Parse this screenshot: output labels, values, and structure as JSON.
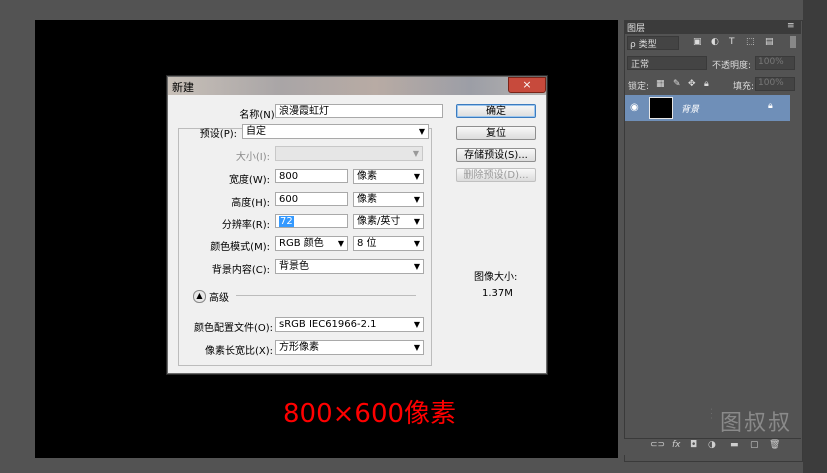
{
  "dialog": {
    "title": "新建",
    "name_label": "名称(N):",
    "name_value": "浪漫霞虹灯",
    "preset_label": "预设(P):",
    "preset_value": "自定",
    "size_label": "大小(I):",
    "width_label": "宽度(W):",
    "width_value": "800",
    "width_unit": "像素",
    "height_label": "高度(H):",
    "height_value": "600",
    "height_unit": "像素",
    "resolution_label": "分辨率(R):",
    "resolution_value": "72",
    "resolution_unit": "像素/英寸",
    "color_mode_label": "颜色模式(M):",
    "color_mode_value": "RGB 颜色",
    "bit_depth_value": "8 位",
    "bg_label": "背景内容(C):",
    "bg_value": "背景色",
    "advanced_label": "高级",
    "profile_label": "颜色配置文件(O):",
    "profile_value": "sRGB IEC61966-2.1",
    "aspect_label": "像素长宽比(X):",
    "aspect_value": "方形像素",
    "ok_label": "确定",
    "reset_label": "复位",
    "save_preset_label": "存储预设(S)...",
    "delete_preset_label": "删除预设(D)...",
    "image_size_label": "图像大小:",
    "image_size_value": "1.37M",
    "close_glyph": "×"
  },
  "layers_panel": {
    "tab_label": "图层",
    "kind_filter": "ρ 类型",
    "blend_mode": "正常",
    "opacity_label": "不透明度:",
    "opacity_value": "100%",
    "lock_label": "锁定:",
    "fill_label": "填充:",
    "fill_value": "100%",
    "layer_name": "背景",
    "footer_icons": [
      "link-icon",
      "fx-icon",
      "mask-icon",
      "adjustment-icon",
      "folder-icon",
      "new-layer-icon",
      "trash-icon"
    ]
  },
  "caption": "800×600像素",
  "watermark": "图叔叔"
}
